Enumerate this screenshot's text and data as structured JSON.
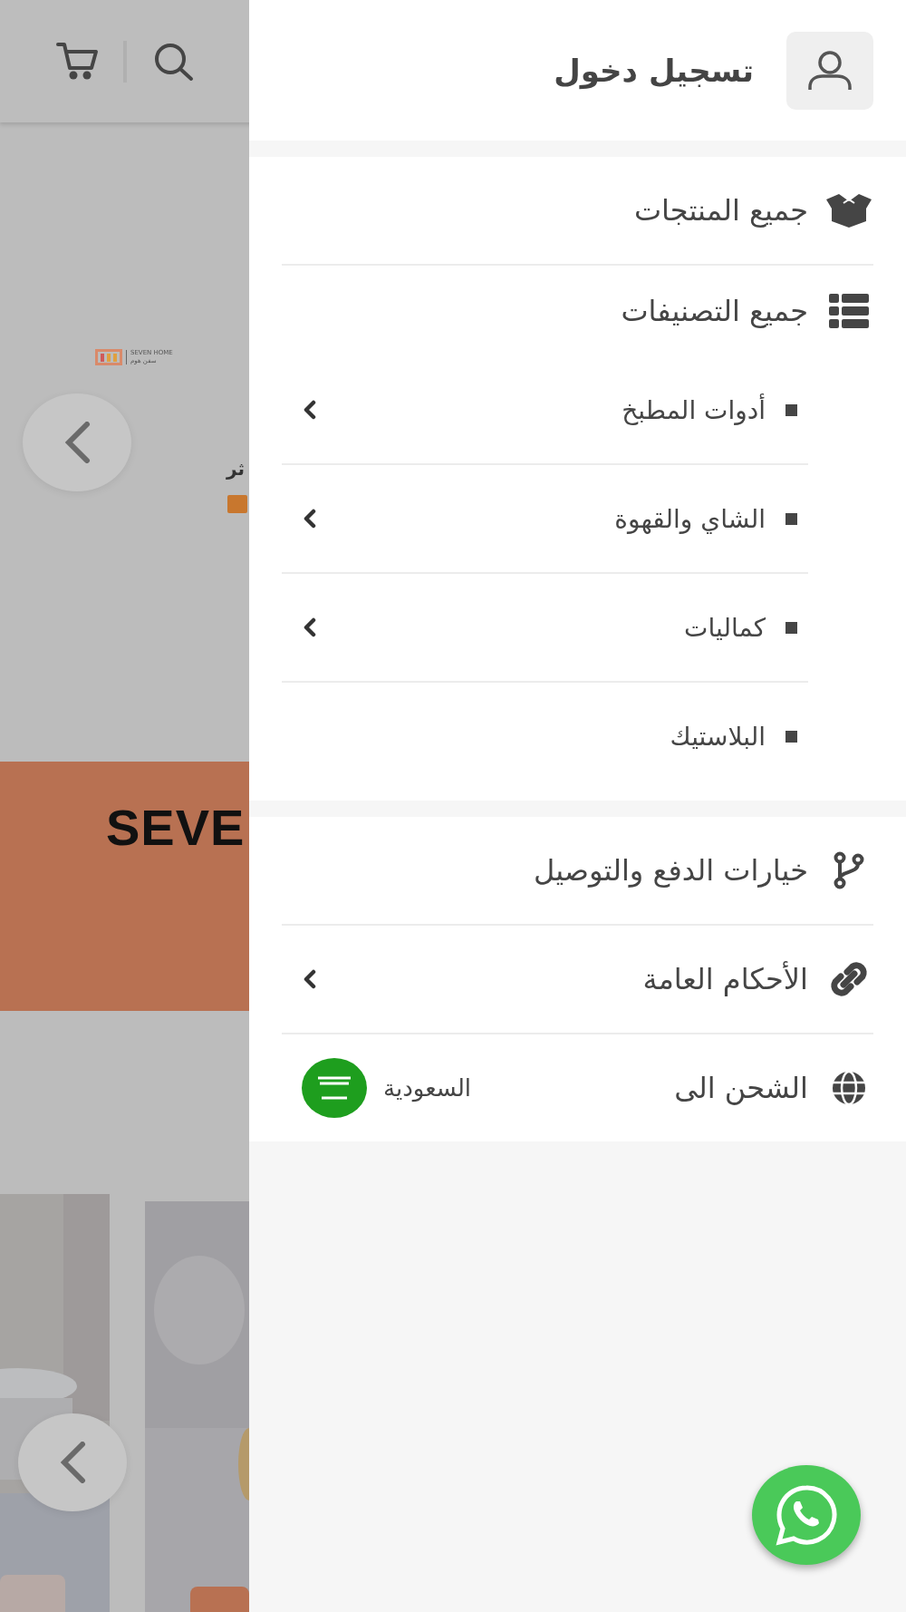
{
  "background_page": {
    "logo": {
      "latin": "SEVEN HOME",
      "arabic": "سفن هوم"
    },
    "slide_text": "ثر",
    "banner_title": "SEVE"
  },
  "drawer": {
    "login": "تسجيل دخول",
    "products": {
      "label": "جميع المنتجات"
    },
    "categories": {
      "label": "جميع التصنيفات",
      "children": [
        {
          "label": "أدوات المطبخ",
          "has_submenu": true
        },
        {
          "label": "الشاي والقهوة",
          "has_submenu": true
        },
        {
          "label": "كماليات",
          "has_submenu": true
        },
        {
          "label": "البلاستيك",
          "has_submenu": false
        }
      ]
    },
    "links": [
      {
        "label": "خيارات الدفع والتوصيل",
        "has_submenu": false
      },
      {
        "label": "الأحكام العامة",
        "has_submenu": true
      }
    ],
    "shipping": {
      "label": "الشحن الى",
      "country": "السعودية"
    }
  }
}
